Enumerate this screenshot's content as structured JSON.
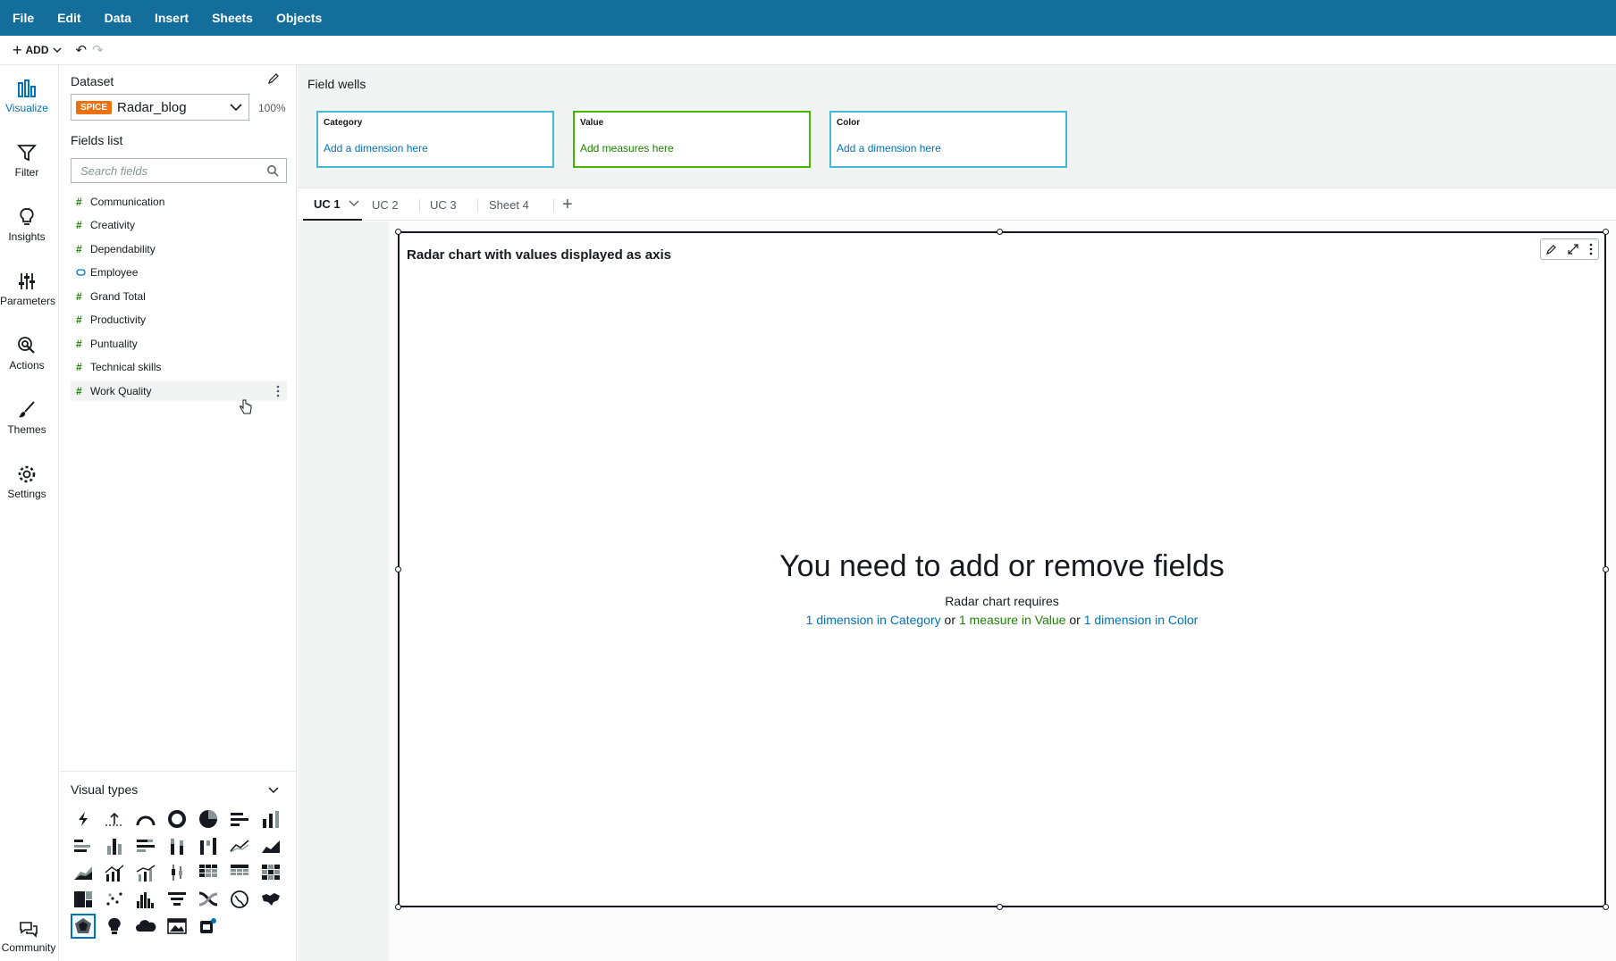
{
  "menubar": {
    "items": [
      "File",
      "Edit",
      "Data",
      "Insert",
      "Sheets",
      "Objects"
    ]
  },
  "toolbar": {
    "add_label": "ADD"
  },
  "rail": {
    "items": [
      {
        "label": "Visualize",
        "icon": "bar-chart-icon",
        "active": true
      },
      {
        "label": "Filter",
        "icon": "filter-icon"
      },
      {
        "label": "Insights",
        "icon": "lightbulb-icon"
      },
      {
        "label": "Parameters",
        "icon": "sliders-icon"
      },
      {
        "label": "Actions",
        "icon": "cursor-click-icon"
      },
      {
        "label": "Themes",
        "icon": "brush-icon"
      },
      {
        "label": "Settings",
        "icon": "gear-icon"
      }
    ],
    "community_label": "Community"
  },
  "dataset": {
    "title": "Dataset",
    "badge": "SPICE",
    "name": "Radar_blog",
    "percent": "100%"
  },
  "fields": {
    "title": "Fields list",
    "search_placeholder": "Search fields",
    "items": [
      {
        "name": "Communication",
        "type": "measure"
      },
      {
        "name": "Creativity",
        "type": "measure"
      },
      {
        "name": "Dependability",
        "type": "measure"
      },
      {
        "name": "Employee",
        "type": "dimension"
      },
      {
        "name": "Grand Total",
        "type": "measure"
      },
      {
        "name": "Productivity",
        "type": "measure"
      },
      {
        "name": "Puntuality",
        "type": "measure"
      },
      {
        "name": "Technical skills",
        "type": "measure"
      },
      {
        "name": "Work Quality",
        "type": "measure"
      }
    ]
  },
  "visual_types": {
    "title": "Visual types"
  },
  "field_wells": {
    "title": "Field wells",
    "wells": [
      {
        "name": "Category",
        "prompt": "Add a dimension here",
        "color": "#44b9d6"
      },
      {
        "name": "Value",
        "prompt": "Add measures here",
        "color": "#44b700"
      },
      {
        "name": "Color",
        "prompt": "Add a dimension here",
        "color": "#44b9d6"
      }
    ]
  },
  "sheet_tabs": [
    "UC 1",
    "UC 2",
    "UC 3",
    "Sheet 4"
  ],
  "visual": {
    "title": "Radar chart with values displayed as axis",
    "message": "You need to add or remove fields",
    "requires": "Radar chart requires",
    "req_category": "1 dimension in Category",
    "req_value": "1 measure in Value",
    "req_color": "1 dimension in Color",
    "or": "or"
  }
}
